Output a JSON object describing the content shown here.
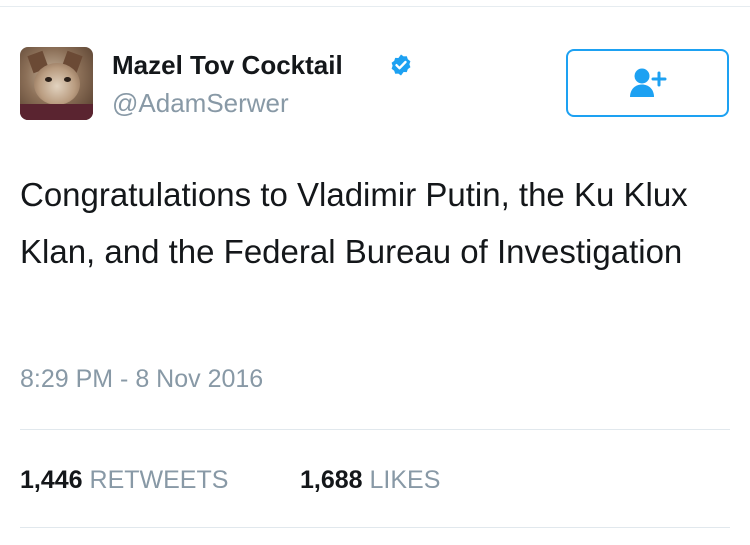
{
  "author": {
    "display_name": "Mazel Tov Cocktail",
    "handle": "@AdamSerwer",
    "verified": true
  },
  "follow_button": {
    "icon": "follow-person-plus-icon"
  },
  "tweet": {
    "text": "Congratulations to Vladimir Putin, the Ku Klux Klan, and the Federal Bureau of Investigation",
    "timestamp": "8:29 PM - 8 Nov 2016"
  },
  "stats": {
    "retweets_count": "1,446",
    "retweets_label": "RETWEETS",
    "likes_count": "1,688",
    "likes_label": "LIKES"
  },
  "colors": {
    "accent": "#1da1f2",
    "secondary_text": "#8899a6",
    "primary_text": "#14171a"
  }
}
